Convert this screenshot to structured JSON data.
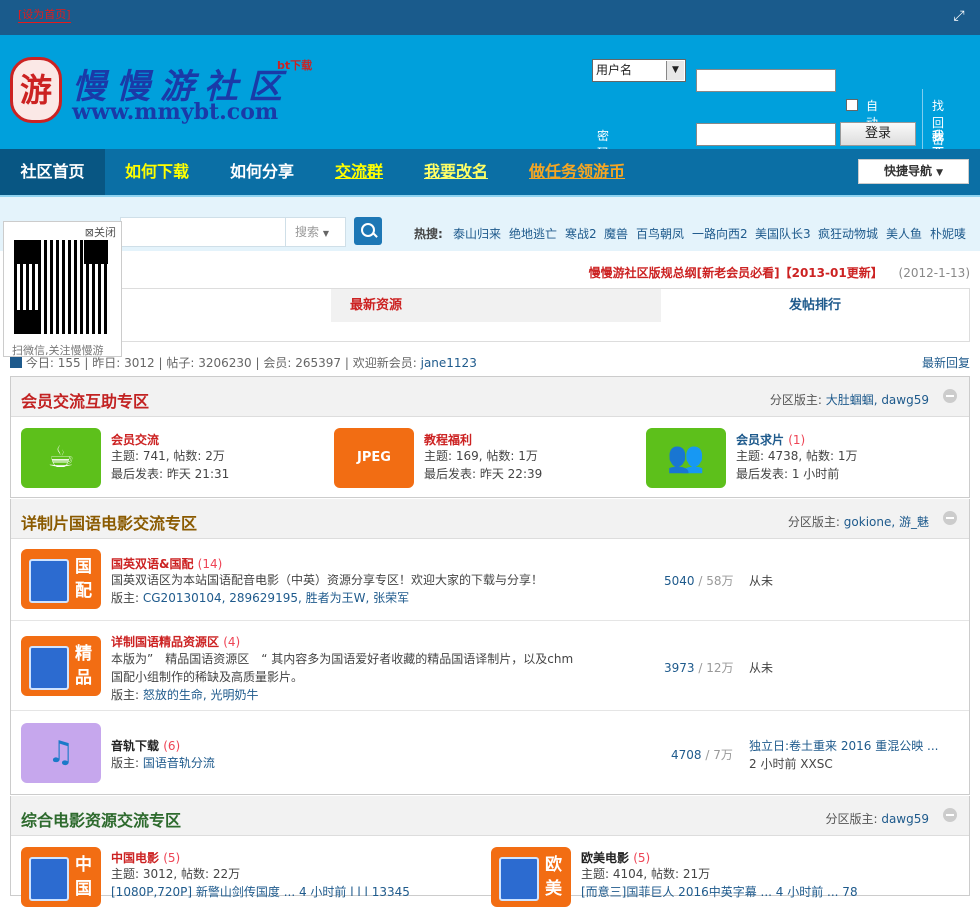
{
  "topbar": {
    "favorite": "[设为首页]"
  },
  "logo": {
    "seal": "游",
    "name": "慢慢游社区",
    "bt": "bt下载",
    "url": "www.mmybt.com"
  },
  "login": {
    "user_select": "用户名",
    "password_label": "密码",
    "auto_login": "自动登录",
    "login_button": "登录",
    "find_password": "找回密码",
    "register": "我要注册"
  },
  "nav": {
    "items": [
      {
        "label": "社区首页",
        "color": "#ffffff"
      },
      {
        "label": "如何下载",
        "color": "#ffff00"
      },
      {
        "label": "如何分享",
        "color": "#ffffff"
      },
      {
        "label": "交流群",
        "color": "#ffff00"
      },
      {
        "label": "我要改名",
        "color": "#ffff66"
      },
      {
        "label": "做任务领游币",
        "color": "#f5a623"
      }
    ],
    "quick_nav": "快捷导航"
  },
  "search": {
    "type": "搜索",
    "hot_label": "热搜:",
    "hot_words": [
      "泰山归来",
      "绝地逃亡",
      "寒战2",
      "魔兽",
      "百鸟朝凤",
      "一路向西2",
      "美国队长3",
      "疯狂动物城",
      "美人鱼",
      "朴妮唛"
    ]
  },
  "qr": {
    "close": "关闭",
    "caption": "扫微信,关注慢慢游"
  },
  "notice": {
    "text": "慢慢游社区版规总纲[新老会员必看]【2013-01更新】",
    "date": "(2012-1-13)"
  },
  "tabs": {
    "latest": "最新资源",
    "posters": "发帖排行"
  },
  "stats": {
    "today_label": "今日:",
    "today": "155",
    "yesterday_label": "昨日:",
    "yesterday": "3012",
    "posts_label": "帖子:",
    "posts": "3206230",
    "members_label": "会员:",
    "members": "265397",
    "welcome": "欢迎新会员:",
    "new_member": "jane1123",
    "latest_reply": "最新回复"
  },
  "boards": [
    {
      "title": "会员交流互助专区",
      "title_color": "#c22222",
      "mod_label": "分区版主:",
      "mods": "大肚蝈蝈, dawg59",
      "forums": [
        {
          "name": "会员交流",
          "new": "",
          "line1": "主题: 741, 帖数: 2万",
          "line2": "最后发表: 昨天 21:31",
          "icon": "cup-icon"
        },
        {
          "name": "教程福利",
          "new": "",
          "line1": "主题: 169, 帖数: 1万",
          "line2": "最后发表: 昨天 22:39",
          "icon": "jpeg-icon"
        },
        {
          "name": "会员求片",
          "new": "(1)",
          "line1": "主题: 4738, 帖数: 1万",
          "line2": "最后发表: 1 小时前",
          "icon": "people-icon"
        }
      ]
    },
    {
      "title": "详制片国语电影交流专区",
      "title_color": "#8a5a00",
      "mod_label": "分区版主:",
      "mods": "gokione, 游_魅",
      "forums": [
        {
          "name": "国英双语&国配",
          "new": "(14)",
          "desc": "国英双语区为本站国语配音电影（中英）资源分享专区！欢迎大家的下载与分享！",
          "mods_label": "版主:",
          "mods": "CG20130104, 289629195, 胜者为王W, 张荣军",
          "count": "5040",
          "total": " / 58万",
          "last": "从未",
          "icon_text": "国配"
        },
        {
          "name": "详制国语精品资源区",
          "new": "(4)",
          "desc": "本版为”　精品国语资源区　“ 其内容多为国语爱好者收藏的精品国语译制片，以及chm",
          "desc2": "国配小组制作的稀缺及高质量影片。",
          "mods_label": "版主:",
          "mods": "怒放的生命, 光明奶牛",
          "count": "3973",
          "total": " / 12万",
          "last": "从未",
          "icon_text": "精品"
        },
        {
          "name": "音轨下载",
          "new": "(6)",
          "mods_label": "版主:",
          "mods": "国语音轨分流",
          "count": "4708",
          "total": " / 7万",
          "last": "独立日:卷土重来 2016 重混公映 ...",
          "last2": "2 小时前 XXSC"
        }
      ]
    },
    {
      "title": "综合电影资源交流专区",
      "title_color": "#2d6a2d",
      "mod_label": "分区版主:",
      "mods": "dawg59",
      "forums": [
        {
          "name": "中国电影",
          "new": "(5)",
          "line1": "主题: 3012, 帖数: 22万",
          "line2": "[1080P,720P] 新警山剑传国度 ... 4 小时前 l l l 13345",
          "icon_text": "中国"
        },
        {
          "name": "欧美电影",
          "new": "(5)",
          "line1": "主题: 4104, 帖数: 21万",
          "line2": "[而意三]国菲巨人 2016中英字幕 ... 4 小时前 ... 78",
          "icon_text": "欧美"
        }
      ]
    }
  ]
}
